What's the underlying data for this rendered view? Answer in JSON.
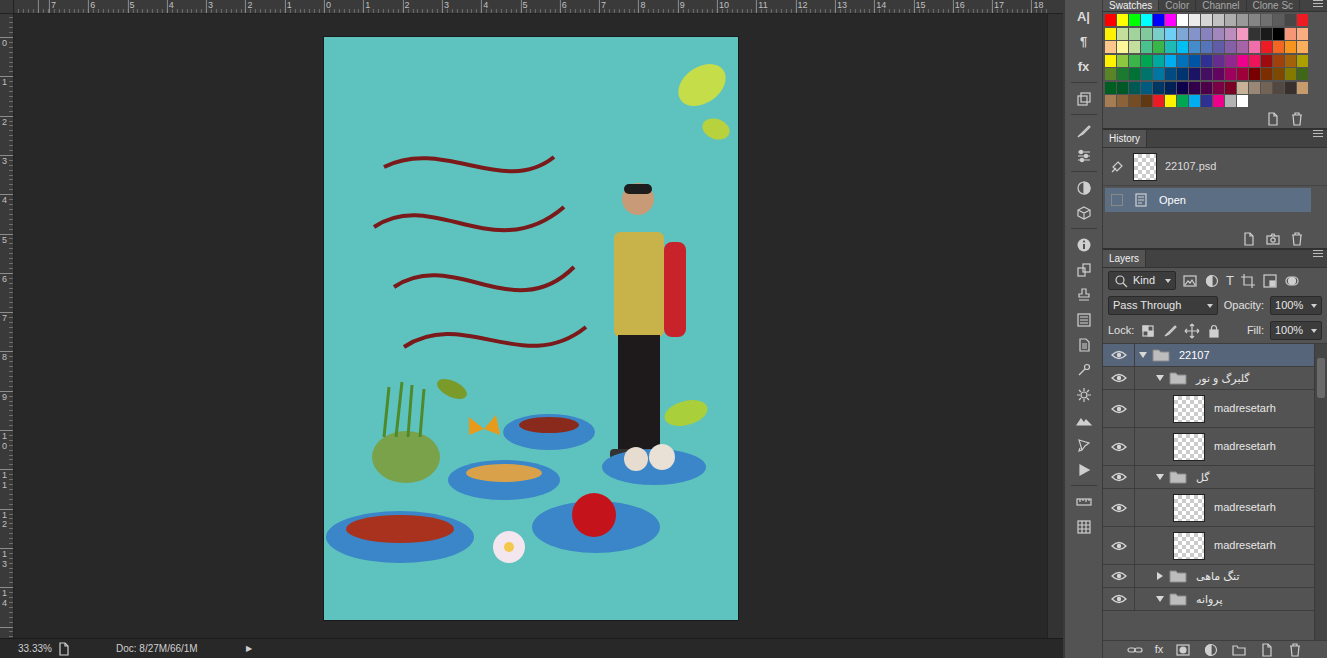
{
  "rulers": {
    "top": [
      "7",
      "6",
      "5",
      "4",
      "3",
      "2",
      "1",
      "0",
      "1",
      "2",
      "3",
      "4",
      "5",
      "6",
      "7",
      "8",
      "9",
      "10",
      "11",
      "12",
      "13",
      "14",
      "15",
      "16",
      "17",
      "18"
    ],
    "left": [
      "0",
      "1",
      "2",
      "3",
      "4",
      "5",
      "6",
      "7",
      "8",
      "9",
      "10",
      "11",
      "12",
      "13",
      "14"
    ]
  },
  "status_bar": {
    "zoom": "33.33%",
    "doc": "Doc: 8/27M/66/1M",
    "menu_arrow": "▶"
  },
  "toolstrip": {
    "glyphs": [
      "A|",
      "¶",
      "fx"
    ]
  },
  "swatches": {
    "tabs": [
      {
        "label": "Swatches",
        "selected": true
      },
      {
        "label": "Color",
        "selected": false
      },
      {
        "label": "Channel",
        "selected": false
      },
      {
        "label": "Clone Sc",
        "selected": false
      }
    ],
    "colors": [
      "#ff0000",
      "#ffff00",
      "#00ff00",
      "#00ffff",
      "#0000ff",
      "#ff00ff",
      "#ffffff",
      "#ebebeb",
      "#d6d6d6",
      "#c2c2c2",
      "#adadad",
      "#999999",
      "#858585",
      "#707070",
      "#5c5c5c",
      "#474747",
      "#ed1c24",
      "#fff200",
      "#c4df9b",
      "#a3d39c",
      "#82ca9d",
      "#7bcdc8",
      "#6ecff6",
      "#7ea7d8",
      "#8493ca",
      "#8882be",
      "#a187be",
      "#bc8dbf",
      "#f49ac2",
      "#333333",
      "#1a1a1a",
      "#000000",
      "#f69679",
      "#f9ad81",
      "#fdc68a",
      "#fff79a",
      "#c4df9b",
      "#4bc28d",
      "#39b54a",
      "#1cbbb4",
      "#00bff3",
      "#448ccb",
      "#5674b9",
      "#605ca8",
      "#855fa8",
      "#a763a8",
      "#f06ea9",
      "#ed1c24",
      "#f26522",
      "#f7941d",
      "#fbaf5d",
      "#fff200",
      "#8dc73f",
      "#39b54a",
      "#00a651",
      "#00a99d",
      "#00aeef",
      "#0072bc",
      "#0054a6",
      "#2e3192",
      "#662d91",
      "#92278f",
      "#ec008c",
      "#ed145b",
      "#9e0b0f",
      "#a0410d",
      "#a36209",
      "#aba000",
      "#598527",
      "#1a7b30",
      "#007236",
      "#00746b",
      "#0076a3",
      "#004b80",
      "#003471",
      "#1b1464",
      "#440e62",
      "#630460",
      "#9e005d",
      "#9e0039",
      "#790000",
      "#7b2e00",
      "#7d4900",
      "#827b00",
      "#406618",
      "#005e20",
      "#005826",
      "#005952",
      "#005b7f",
      "#003663",
      "#002157",
      "#0d004c",
      "#32004b",
      "#4b0049",
      "#7b0046",
      "#7a0026",
      "#c7b299",
      "#998675",
      "#736357",
      "#534741",
      "#37302d",
      "#c69c6d",
      "#a67c52",
      "#8c6239",
      "#754c24",
      "#603913",
      "#ed1c24",
      "#fff200",
      "#00a651",
      "#00aeef",
      "#2e3192",
      "#ec008c",
      "#b3b3b3",
      "#ffffff"
    ]
  },
  "history": {
    "title": "History",
    "snapshot": "22107.psd",
    "steps": [
      {
        "label": "Open",
        "selected": true
      }
    ]
  },
  "layers": {
    "title": "Layers",
    "filter": {
      "label": "Kind",
      "type_glyph": "T"
    },
    "blend_mode": "Pass Through",
    "opacity_label": "Opacity:",
    "opacity": "100%",
    "lock_label": "Lock:",
    "fill_label": "Fill:",
    "fill": "100%",
    "footer_fx": "fx",
    "items": [
      {
        "name": "22107",
        "kind": "group",
        "depth": 0,
        "expanded": true,
        "selected": true,
        "visible": true
      },
      {
        "name": "گلبرگ و نور",
        "kind": "group",
        "depth": 1,
        "expanded": true,
        "selected": false,
        "visible": true
      },
      {
        "name": "madresetarh",
        "kind": "pixel",
        "depth": 2,
        "expanded": false,
        "selected": false,
        "visible": true
      },
      {
        "name": "madresetarh",
        "kind": "pixel",
        "depth": 2,
        "expanded": false,
        "selected": false,
        "visible": true
      },
      {
        "name": "گل",
        "kind": "group",
        "depth": 1,
        "expanded": true,
        "selected": false,
        "visible": true
      },
      {
        "name": "madresetarh",
        "kind": "pixel",
        "depth": 2,
        "expanded": false,
        "selected": false,
        "visible": true
      },
      {
        "name": "madresetarh",
        "kind": "pixel",
        "depth": 2,
        "expanded": false,
        "selected": false,
        "visible": true
      },
      {
        "name": "تنگ ماهی",
        "kind": "group",
        "depth": 1,
        "expanded": false,
        "selected": false,
        "visible": true
      },
      {
        "name": "پروانه",
        "kind": "group",
        "depth": 1,
        "expanded": true,
        "selected": false,
        "visible": true
      }
    ]
  }
}
